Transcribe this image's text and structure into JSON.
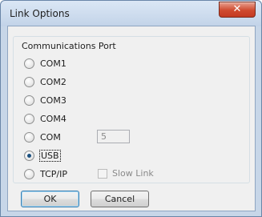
{
  "window": {
    "title": "Link Options",
    "close_glyph": "✕"
  },
  "group": {
    "label": "Communications Port"
  },
  "ports": [
    {
      "label": "COM1",
      "checked": false
    },
    {
      "label": "COM2",
      "checked": false
    },
    {
      "label": "COM3",
      "checked": false
    },
    {
      "label": "COM4",
      "checked": false
    },
    {
      "label": "COM",
      "checked": false
    },
    {
      "label": "USB",
      "checked": true
    },
    {
      "label": "TCP/IP",
      "checked": false
    }
  ],
  "com_number": "5",
  "slow_link": {
    "label": "Slow Link",
    "checked": false,
    "enabled": false
  },
  "buttons": {
    "ok": "OK",
    "cancel": "Cancel"
  },
  "colors": {
    "frame": "#c7d6e8",
    "close_button": "#cf4a2f",
    "client_bg": "#f0f0f0",
    "radio_dot": "#1c5180"
  }
}
